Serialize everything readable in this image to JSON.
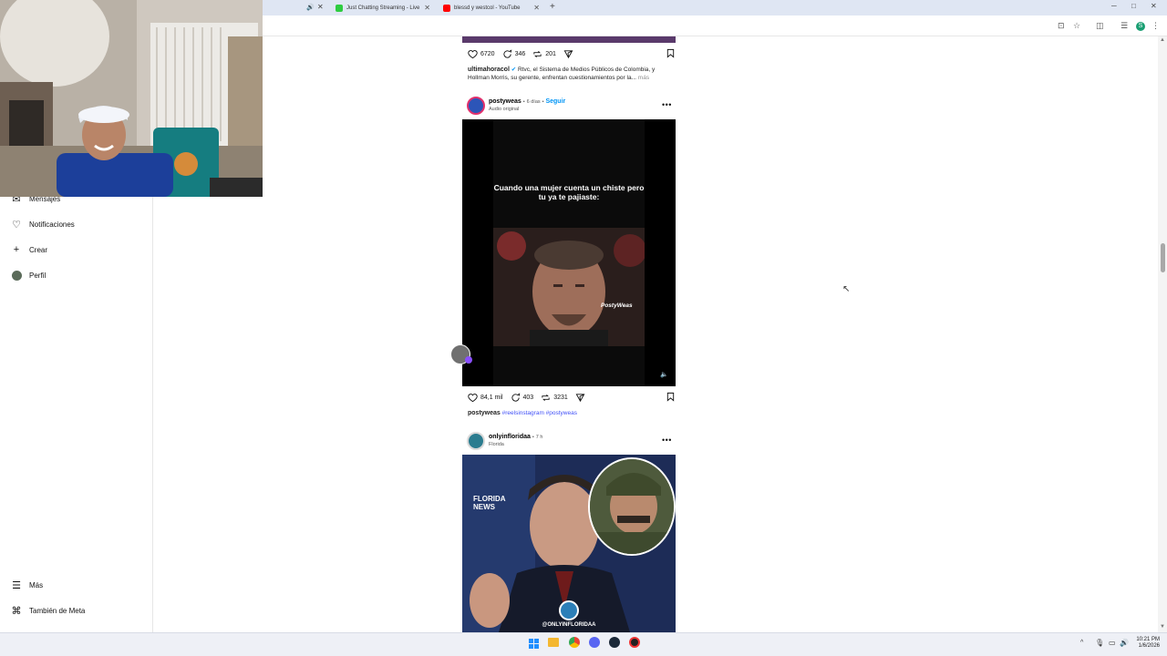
{
  "browser": {
    "tabs": [
      {
        "title": "Just Chatting Streaming - Live",
        "color": "#2ecc40"
      },
      {
        "title": "blessd y westcol - YouTube",
        "color": "#ff0000"
      }
    ],
    "new_tab_label": "+",
    "profile_letter": "S"
  },
  "sidebar": {
    "items": [
      {
        "label": "Mensajes",
        "icon": "messenger-icon"
      },
      {
        "label": "Notificaciones",
        "icon": "heart-icon"
      },
      {
        "label": "Crear",
        "icon": "plus-icon"
      },
      {
        "label": "Perfil",
        "icon": "avatar-icon"
      }
    ],
    "bottom_items": [
      {
        "label": "Más",
        "icon": "menu-icon"
      },
      {
        "label": "También de Meta",
        "icon": "meta-icon"
      }
    ]
  },
  "feed": {
    "post1": {
      "likes": "6720",
      "comments": "346",
      "reposts": "201",
      "username": "ultimahoracol",
      "caption_line1": "Rtvc, el Sistema de Medios Públicos de Colombia, y",
      "caption_line2": "Hollman Morris, su gerente, enfrentan cuestionamientos por la...",
      "more": "más"
    },
    "post2": {
      "username": "postyweas",
      "time": "6 días",
      "follow": "Seguir",
      "sep": "•",
      "audio": "Audio original",
      "video_text": "Cuando una mujer cuenta un chiste pero tu ya te pajiaste:",
      "watermark": "PostyWeas",
      "likes": "84,1 mil",
      "comments": "403",
      "reposts": "3231",
      "caption_user": "postyweas",
      "hashtags": "#reelsinstagram #postyweas"
    },
    "post3": {
      "username": "onlyinfloridaa",
      "time": "7 h",
      "location": "Florida",
      "overlay_title": "FLORIDA NEWS",
      "handle": "@ONLYINFLORIDAA"
    }
  },
  "taskbar": {
    "time": "10:21 PM",
    "date": "1/6/2026"
  }
}
